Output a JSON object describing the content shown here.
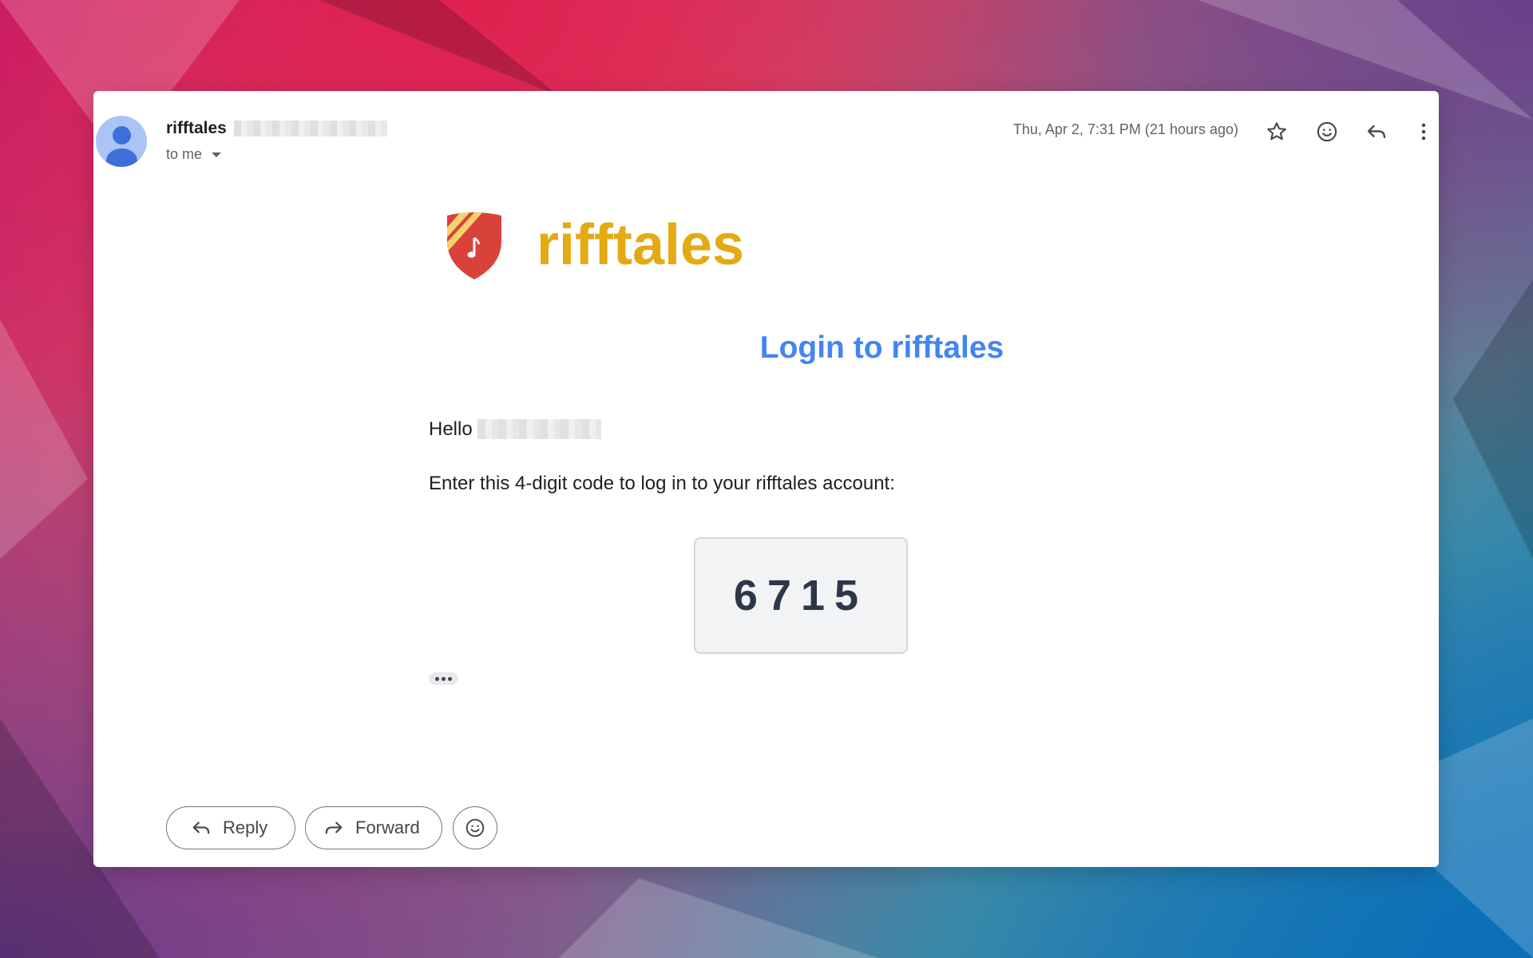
{
  "email": {
    "sender_name": "rifftales",
    "recipients_label": "to me",
    "date": "Thu, Apr 2, 7:31 PM (21 hours ago)"
  },
  "header_icons": [
    "star-icon",
    "emoji-icon",
    "reply-icon",
    "more-vert-icon"
  ],
  "body": {
    "brand_name": "rifftales",
    "title": "Login to rifftales",
    "greeting": "Hello",
    "instruction": "Enter this 4-digit code to log in to your rifftales account:",
    "code": "6715"
  },
  "actions": {
    "reply_label": "Reply",
    "forward_label": "Forward"
  },
  "colors": {
    "brand_yellow": "#e5a914",
    "title_blue": "#4285f4",
    "shield_red": "#d9413b",
    "avatar_blue": "#3d6fdb"
  }
}
